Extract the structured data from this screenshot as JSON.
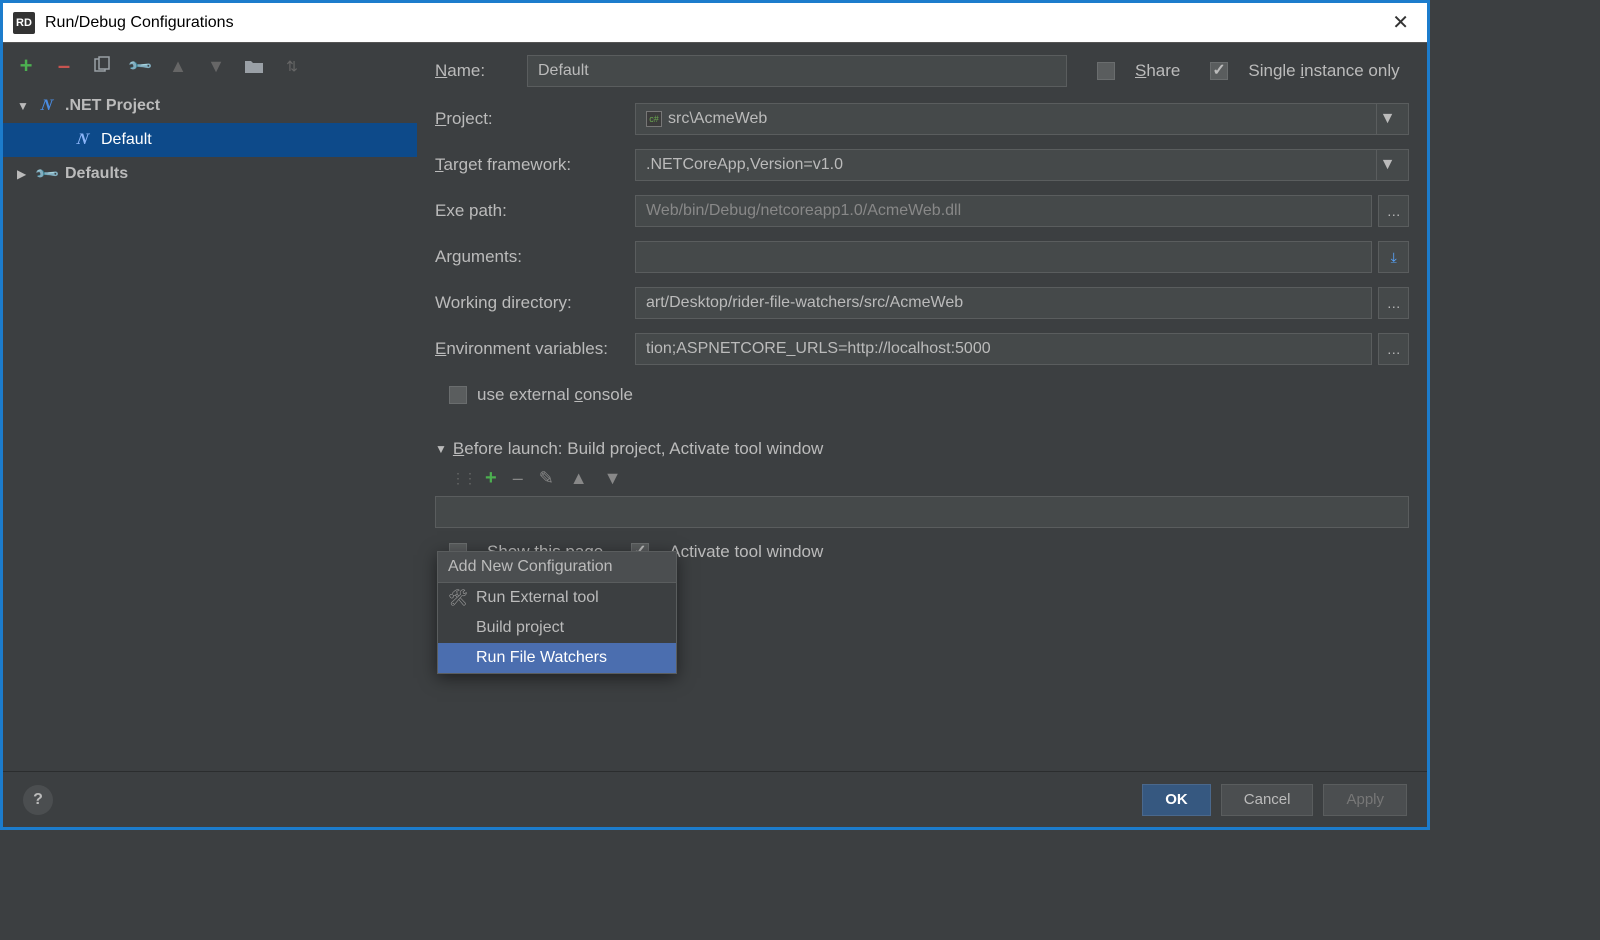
{
  "titlebar": {
    "app_badge": "RD",
    "title": "Run/Debug Configurations"
  },
  "toolbar": {
    "plus": "+",
    "minus": "–"
  },
  "tree": {
    "net_project": {
      "label": ".NET Project"
    },
    "default_item": {
      "label": "Default"
    },
    "defaults": {
      "label": "Defaults"
    }
  },
  "form": {
    "name_label": "Name:",
    "name_value": "Default",
    "share_label": "Share",
    "single_instance_label": "Single instance only",
    "project_label": "Project:",
    "project_value": "src\\AcmeWeb",
    "target_label": "Target framework:",
    "target_value": ".NETCoreApp,Version=v1.0",
    "exe_label": "Exe path:",
    "exe_value": "Web/bin/Debug/netcoreapp1.0/AcmeWeb.dll",
    "args_label": "Arguments:",
    "args_value": "",
    "wd_label": "Working directory:",
    "wd_value": "art/Desktop/rider-file-watchers/src/AcmeWeb",
    "env_label": "Environment variables:",
    "env_value": "tion;ASPNETCORE_URLS=http://localhost:5000",
    "ext_console_label": "use external console"
  },
  "before_launch": {
    "header": "Before launch: Build project, Activate tool window",
    "show_page_label": "Show this page",
    "activate_label": "Activate tool window"
  },
  "popup": {
    "title": "Add New Configuration",
    "items": [
      {
        "label": "Run External tool",
        "icon": "tools"
      },
      {
        "label": "Build project",
        "icon": ""
      },
      {
        "label": "Run File Watchers",
        "icon": "",
        "highlighted": true
      }
    ]
  },
  "footer": {
    "ok": "OK",
    "cancel": "Cancel",
    "apply": "Apply"
  }
}
